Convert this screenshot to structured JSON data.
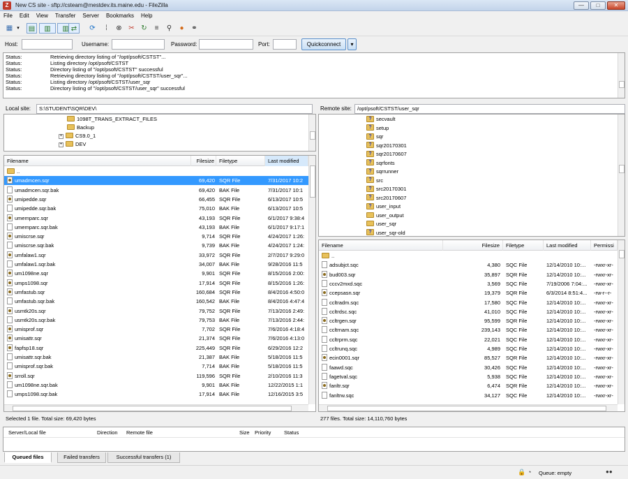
{
  "window": {
    "title": "New CS site - sftp://csteam@mestdev.its.maine.edu - FileZilla"
  },
  "menu": [
    "File",
    "Edit",
    "View",
    "Transfer",
    "Server",
    "Bookmarks",
    "Help"
  ],
  "quickconnect": {
    "host_label": "Host:",
    "username_label": "Username:",
    "password_label": "Password:",
    "port_label": "Port:",
    "button": "Quickconnect"
  },
  "log": [
    {
      "k": "Status:",
      "m": "Retrieving directory listing of \"/opt/psoft/CSTST\"..."
    },
    {
      "k": "Status:",
      "m": "Listing directory /opt/psoft/CSTST"
    },
    {
      "k": "Status:",
      "m": "Directory listing of \"/opt/psoft/CSTST\" successful"
    },
    {
      "k": "Status:",
      "m": "Retrieving directory listing of \"/opt/psoft/CSTST/user_sqr\"..."
    },
    {
      "k": "Status:",
      "m": "Listing directory /opt/psoft/CSTST/user_sqr"
    },
    {
      "k": "Status:",
      "m": "Directory listing of \"/opt/psoft/CSTST/user_sqr\" successful"
    }
  ],
  "local": {
    "site_label": "Local site:",
    "site_path": "S:\\STUDENT\\SQR\\DEV\\",
    "tree": [
      {
        "name": "1098T_TRANS_EXTRACT_FILES",
        "expand": ""
      },
      {
        "name": "Backup",
        "expand": ""
      },
      {
        "name": "CS9.0_1",
        "expand": "+"
      },
      {
        "name": "DEV",
        "expand": "+"
      }
    ],
    "headers": [
      "Filename",
      "Filesize",
      "Filetype",
      "Last modified"
    ],
    "files": [
      {
        "n": "..",
        "s": "",
        "t": "",
        "d": "",
        "i": "folder"
      },
      {
        "n": "umadmcen.sqr",
        "s": "69,420",
        "t": "SQR File",
        "d": "7/31/2017 10:2",
        "i": "sqr"
      },
      {
        "n": "umadmcen.sqr.bak",
        "s": "69,420",
        "t": "BAK File",
        "d": "7/31/2017 10:1",
        "i": "bak"
      },
      {
        "n": "umipedde.sqr",
        "s": "66,455",
        "t": "SQR File",
        "d": "6/13/2017 10:5",
        "i": "sqr"
      },
      {
        "n": "umipedde.sqr.bak",
        "s": "75,010",
        "t": "BAK File",
        "d": "6/13/2017 10:5",
        "i": "bak"
      },
      {
        "n": "umemparc.sqr",
        "s": "43,193",
        "t": "SQR File",
        "d": "6/1/2017 9:38:4",
        "i": "sqr"
      },
      {
        "n": "umemparc.sqr.bak",
        "s": "43,193",
        "t": "BAK File",
        "d": "6/1/2017 9:17:1",
        "i": "bak"
      },
      {
        "n": "umiscrse.sqr",
        "s": "9,714",
        "t": "SQR File",
        "d": "4/24/2017 1:26:",
        "i": "sqr"
      },
      {
        "n": "umiscrse.sqr.bak",
        "s": "9,739",
        "t": "BAK File",
        "d": "4/24/2017 1:24:",
        "i": "bak"
      },
      {
        "n": "umfalaw1.sqr",
        "s": "33,972",
        "t": "SQR File",
        "d": "2/7/2017 9:29:0",
        "i": "sqr"
      },
      {
        "n": "umfalaw1.sqr.bak",
        "s": "34,007",
        "t": "BAK File",
        "d": "9/28/2016 11:5",
        "i": "bak"
      },
      {
        "n": "um1098ne.sqr",
        "s": "9,901",
        "t": "SQR File",
        "d": "8/15/2016 2:00:",
        "i": "sqr"
      },
      {
        "n": "umps1098.sqr",
        "s": "17,914",
        "t": "SQR File",
        "d": "8/15/2016 1:26:",
        "i": "sqr"
      },
      {
        "n": "umfastub.sqr",
        "s": "160,684",
        "t": "SQR File",
        "d": "8/4/2016 4:50:0",
        "i": "sqr"
      },
      {
        "n": "umfastub.sqr.bak",
        "s": "160,542",
        "t": "BAK File",
        "d": "8/4/2016 4:47:4",
        "i": "bak"
      },
      {
        "n": "usmtk20s.sqr",
        "s": "79,752",
        "t": "SQR File",
        "d": "7/13/2016 2:49:",
        "i": "sqr"
      },
      {
        "n": "usmtk20s.sqr.bak",
        "s": "79,753",
        "t": "BAK File",
        "d": "7/13/2016 2:44:",
        "i": "bak"
      },
      {
        "n": "umisprof.sqr",
        "s": "7,702",
        "t": "SQR File",
        "d": "7/6/2016 4:18:4",
        "i": "sqr"
      },
      {
        "n": "umisattr.sqr",
        "s": "21,374",
        "t": "SQR File",
        "d": "7/6/2016 4:13:0",
        "i": "sqr"
      },
      {
        "n": "fapfsp18.sqr",
        "s": "225,449",
        "t": "SQR File",
        "d": "6/29/2016 12:2",
        "i": "sqr"
      },
      {
        "n": "umisattr.sqr.bak",
        "s": "21,387",
        "t": "BAK File",
        "d": "5/18/2016 11:5",
        "i": "bak"
      },
      {
        "n": "umisprof.sqr.bak",
        "s": "7,714",
        "t": "BAK File",
        "d": "5/18/2016 11:5",
        "i": "bak"
      },
      {
        "n": "srroll.sqr",
        "s": "119,596",
        "t": "SQR File",
        "d": "2/10/2016 11:3",
        "i": "sqr"
      },
      {
        "n": "um1098ne.sqr.bak",
        "s": "9,901",
        "t": "BAK File",
        "d": "12/22/2015 1:1",
        "i": "bak"
      },
      {
        "n": "umps1098.sqr.bak",
        "s": "17,914",
        "t": "BAK File",
        "d": "12/16/2015 3:5",
        "i": "bak"
      }
    ],
    "status": "Selected 1 file. Total size: 69,420 bytes"
  },
  "remote": {
    "site_label": "Remote site:",
    "site_path": "/opt/psoft/CSTST/user_sqr",
    "tree": [
      {
        "name": "secvault",
        "q": true
      },
      {
        "name": "setup",
        "q": true
      },
      {
        "name": "sqr",
        "q": true
      },
      {
        "name": "sqr20170301",
        "q": true
      },
      {
        "name": "sqr20170607",
        "q": true
      },
      {
        "name": "sqrfonts",
        "q": true
      },
      {
        "name": "sqrrunner",
        "q": true
      },
      {
        "name": "src",
        "q": true
      },
      {
        "name": "src20170301",
        "q": true
      },
      {
        "name": "src20170607",
        "q": true
      },
      {
        "name": "user_input",
        "q": true
      },
      {
        "name": "user_output",
        "q": false
      },
      {
        "name": "user_sqr",
        "q": false
      },
      {
        "name": "user_sqr-old",
        "q": true
      }
    ],
    "headers": [
      "Filename",
      "Filesize",
      "Filetype",
      "Last modified",
      "Permissi"
    ],
    "files": [
      {
        "n": "..",
        "s": "",
        "t": "",
        "d": "",
        "p": "",
        "i": "folder"
      },
      {
        "n": "adsubjct.sqc",
        "s": "4,380",
        "t": "SQC File",
        "d": "12/14/2010 10:...",
        "p": "-rwxr-xr-",
        "i": "bak"
      },
      {
        "n": "bud003.sqr",
        "s": "35,897",
        "t": "SQR File",
        "d": "12/14/2010 10:...",
        "p": "-rwxr-xr-",
        "i": "sqr"
      },
      {
        "n": "cccv2mxd.sqc",
        "s": "3,569",
        "t": "SQC File",
        "d": "7/19/2006 7:04:...",
        "p": "-rwxr-xr-",
        "i": "bak"
      },
      {
        "n": "ccepsasn.sqr",
        "s": "19,379",
        "t": "SQR File",
        "d": "6/3/2014 8:51:4...",
        "p": "-rw-r--r-",
        "i": "sqr"
      },
      {
        "n": "ccltradm.sqc",
        "s": "17,580",
        "t": "SQC File",
        "d": "12/14/2010 10:...",
        "p": "-rwxr-xr-",
        "i": "bak"
      },
      {
        "n": "ccltrdsc.sqc",
        "s": "41,010",
        "t": "SQC File",
        "d": "12/14/2010 10:...",
        "p": "-rwxr-xr-",
        "i": "bak"
      },
      {
        "n": "ccltrgen.sqr",
        "s": "95,599",
        "t": "SQR File",
        "d": "12/14/2010 10:...",
        "p": "-rwxr-xr-",
        "i": "sqr"
      },
      {
        "n": "ccltrnam.sqc",
        "s": "239,143",
        "t": "SQC File",
        "d": "12/14/2010 10:...",
        "p": "-rwxr-xr-",
        "i": "bak"
      },
      {
        "n": "ccltrprm.sqc",
        "s": "22,021",
        "t": "SQC File",
        "d": "12/14/2010 10:...",
        "p": "-rwxr-xr-",
        "i": "bak"
      },
      {
        "n": "ccltrunq.sqc",
        "s": "4,989",
        "t": "SQC File",
        "d": "12/14/2010 10:...",
        "p": "-rwxr-xr-",
        "i": "bak"
      },
      {
        "n": "ecin0001.sqr",
        "s": "85,527",
        "t": "SQR File",
        "d": "12/14/2010 10:...",
        "p": "-rwxr-xr-",
        "i": "sqr"
      },
      {
        "n": "faawd.sqc",
        "s": "30,426",
        "t": "SQC File",
        "d": "12/14/2010 10:...",
        "p": "-rwxr-xr-",
        "i": "bak"
      },
      {
        "n": "fagetval.sqc",
        "s": "5,938",
        "t": "SQC File",
        "d": "12/14/2010 10:...",
        "p": "-rwxr-xr-",
        "i": "bak"
      },
      {
        "n": "fanltr.sqr",
        "s": "6,474",
        "t": "SQR File",
        "d": "12/14/2010 10:...",
        "p": "-rwxr-xr-",
        "i": "sqr"
      },
      {
        "n": "fanltrw.sqc",
        "s": "34,127",
        "t": "SQC File",
        "d": "12/14/2010 10:...",
        "p": "-rwxr-xr-",
        "i": "bak"
      }
    ],
    "status": "277 files. Total size: 14,110,760 bytes"
  },
  "queue": {
    "headers": [
      "Server/Local file",
      "Direction",
      "Remote file",
      "Size",
      "Priority",
      "Status"
    ]
  },
  "tabs": [
    "Queued files",
    "Failed transfers",
    "Successful transfers (1)"
  ],
  "bottom": {
    "queue": "Queue: empty"
  }
}
